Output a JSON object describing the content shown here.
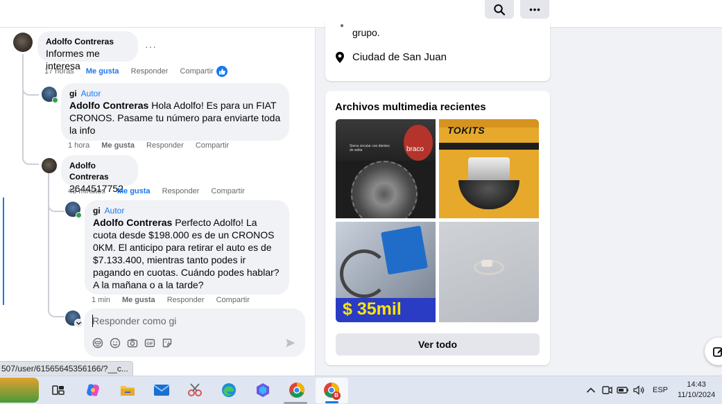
{
  "topbar": {
    "search_icon": "search-icon",
    "more_icon": "more-icon"
  },
  "comments": {
    "c1": {
      "author": "Adolfo Contreras",
      "text": "Informes me interesa",
      "time": "17 horas",
      "like": "Me gusta",
      "reply": "Responder",
      "share": "Compartir",
      "more": "···"
    },
    "r1": {
      "author": "gi",
      "badge": "Autor",
      "mention": "Adolfo Contreras",
      "text": " Hola Adolfo! Es para un FIAT CRONOS. Pasame tu número para enviarte toda la info",
      "time": "1 hora",
      "like": "Me gusta",
      "reply": "Responder",
      "share": "Compartir"
    },
    "c2": {
      "author": "Adolfo Contreras",
      "text": "2644517752",
      "time": "48 minutos",
      "like": "Me gusta",
      "reply": "Responder",
      "share": "Compartir"
    },
    "r2": {
      "author": "gi",
      "badge": "Autor",
      "mention": "Adolfo Contreras",
      "text": " Perfecto Adolfo! La cuota desde $198.000 es de un CRONOS 0KM. El anticipo para retirar el auto es de $7.133.400, mientras tanto podes ir pagando en cuotas. Cuándo podes hablar? A la mañana o a la tarde?",
      "time": "1 min",
      "like": "Me gusta",
      "reply": "Responder",
      "share": "Compartir"
    }
  },
  "reply_box": {
    "placeholder": "Responder como gi"
  },
  "about": {
    "group_tail": "grupo.",
    "location": "Ciudad de San Juan"
  },
  "media": {
    "title": "Archivos multimedia recientes",
    "items": [
      {
        "caption": "braco",
        "subcaption": "Sierra circular con dientes de widia"
      },
      {
        "caption": "TOKITS"
      },
      {
        "caption": "$ 35mil"
      },
      {
        "caption": ""
      }
    ],
    "see_all": "Ver todo"
  },
  "status_url": "507/user/61565645356166/?__c...",
  "taskbar": {
    "language": "ESP",
    "time": "14:43",
    "date": "11/10/2024",
    "chrome_badge": "B"
  },
  "colors": {
    "accent": "#1877f2",
    "bubble": "#f0f2f5",
    "page_bg": "#f0f2f5"
  }
}
